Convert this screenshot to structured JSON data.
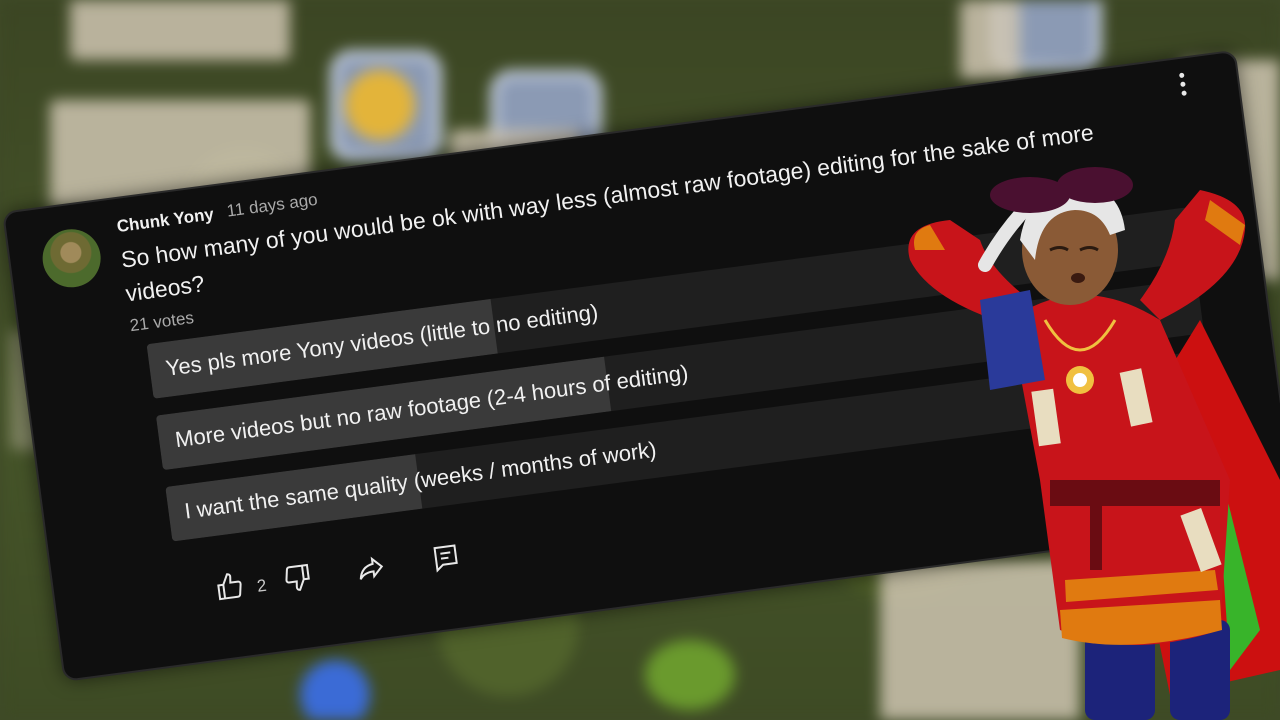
{
  "comment": {
    "author": "Chunk Yony",
    "time": "11 days ago",
    "text": "So how many of you would be ok with way less (almost raw footage) editing for the sake of more videos?",
    "votes": "21 votes",
    "options": [
      {
        "label": "Yes pls more Yony videos (little to no editing)",
        "share": 0.33
      },
      {
        "label": "More videos but no raw footage (2-4 hours of editing)",
        "share": 0.43
      },
      {
        "label": "I want the same quality (weeks / months of work)",
        "share": 0.24
      }
    ],
    "likes": "2"
  },
  "icons": {
    "menu": "more-vert-icon",
    "like": "thumb-up-icon",
    "dislike": "thumb-down-icon",
    "share": "share-icon",
    "reply": "comment-icon"
  },
  "colors": {
    "card": "#0f0f0f",
    "poll_fill": "#3a3a3a",
    "poll_track": "#1f1f1f",
    "text": "#f1f1f1",
    "meta": "#aaaaaa"
  }
}
